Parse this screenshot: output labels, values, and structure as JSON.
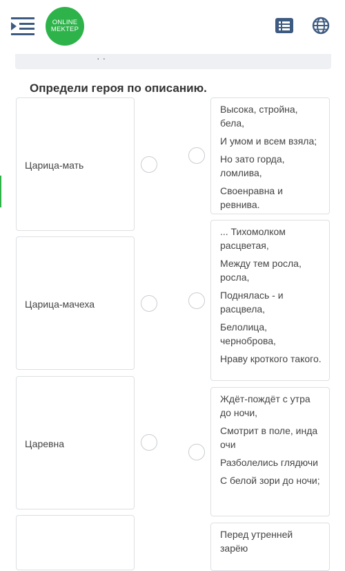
{
  "header": {
    "logo_line1": "ONLINE",
    "logo_line2": "MEKTEP",
    "brand_color": "#2db34a"
  },
  "strip": {
    "text": "· ·"
  },
  "question": "Определи героя по описанию.",
  "left_items": [
    {
      "label": "Царица-мать"
    },
    {
      "label": "Царица-мачеха"
    },
    {
      "label": "Царевна"
    },
    {
      "label": ""
    }
  ],
  "right_items": [
    {
      "lines": [
        "Высока, стройна, бела,",
        "И умом и всем взяла;",
        "Но зато горда, ломлива,",
        "Своенравна и ревнива."
      ]
    },
    {
      "lines": [
        "... Тихомолком расцветая,",
        "Между тем росла, росла,",
        "Поднялась - и расцвела,",
        "Белолица, черноброва,",
        "Нраву кроткого такого."
      ]
    },
    {
      "lines": [
        "Ждёт-пождёт с утра до ночи,",
        "Смотрит в поле, инда очи",
        "Разболелись глядючи",
        "С белой зори до ночи;"
      ]
    },
    {
      "lines": [
        "Перед утренней зарёю"
      ]
    }
  ]
}
